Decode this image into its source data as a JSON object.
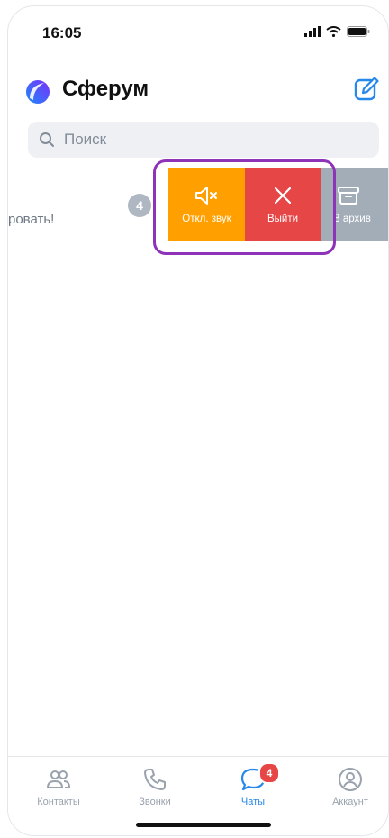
{
  "status_bar": {
    "time": "16:05"
  },
  "header": {
    "title": "Сферум"
  },
  "search": {
    "placeholder": "Поиск"
  },
  "chat": {
    "preview_text": "ровать!",
    "unread_count": "4"
  },
  "swipe_actions": {
    "mute_label": "Откл. звук",
    "leave_label": "Выйти",
    "archive_label": "В архив"
  },
  "colors": {
    "mute": "#ffa000",
    "leave": "#e64646",
    "archive": "#a3adb8",
    "highlight": "#8e32b8",
    "accent": "#2688eb"
  },
  "tabs": [
    {
      "label": "Контакты",
      "icon": "contacts-icon",
      "active": false
    },
    {
      "label": "Звонки",
      "icon": "phone-icon",
      "active": false
    },
    {
      "label": "Чаты",
      "icon": "chat-bubble-icon",
      "active": true,
      "badge": "4"
    },
    {
      "label": "Аккаунт",
      "icon": "account-icon",
      "active": false
    }
  ]
}
